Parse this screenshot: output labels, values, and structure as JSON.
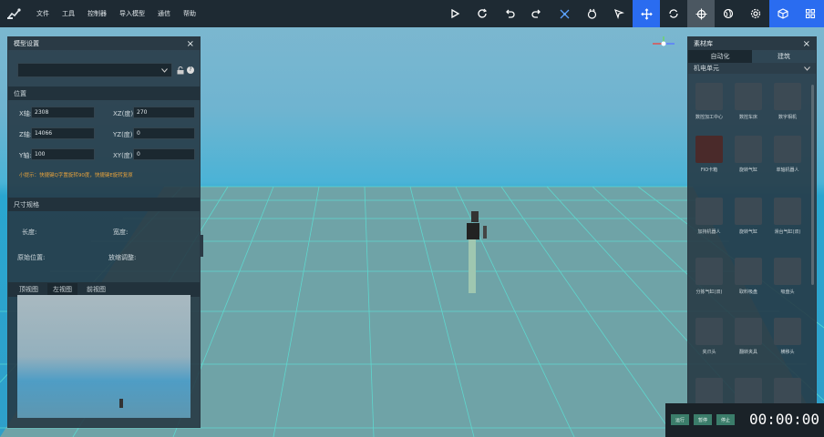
{
  "menu": [
    "文件",
    "工具",
    "控制器",
    "导入模型",
    "通信",
    "帮助"
  ],
  "tool_icons": [
    "play-icon",
    "refresh-icon",
    "undo-icon",
    "redo-icon",
    "drone-icon",
    "robot-hand-icon",
    "cursor-icon",
    "move-icon",
    "rotate-icon",
    "target-icon",
    "globe-icon",
    "gear-icon",
    "cube-icon",
    "grid-icon"
  ],
  "model_panel": {
    "title": "模型设置",
    "close": "×",
    "position_section": "位置",
    "fields": {
      "x_label": "X轴:",
      "x_value": "2308",
      "xz_label": "XZ(度):",
      "xz_value": "270",
      "z_label": "Z轴:",
      "z_value": "14066",
      "yz_label": "YZ(度):",
      "yz_value": "0",
      "y_label": "Y轴:",
      "y_value": "100",
      "xy_label": "XY(度):",
      "xy_value": "0"
    },
    "hint": "小提示：快捷键Q字置旋转90度，快捷键E旋转复原",
    "size_section": "尺寸规格",
    "length_label": "长度:",
    "width_label": "宽度:",
    "origin_label": "原始位置:",
    "speed_label": "放缩调整:",
    "view_tabs": [
      "顶视图",
      "左视图",
      "前视图"
    ],
    "active_tab": 1
  },
  "library_panel": {
    "title": "素材库",
    "close": "×",
    "tabs": [
      "自动化",
      "建筑"
    ],
    "category": "机电单元",
    "items": [
      "数控加工中心",
      "数控车床",
      "数字相机",
      "FIO卡箱",
      "旋转气缸",
      "单轴机器人",
      "加持机器人",
      "旋转气缸",
      "滑台气缸(双)",
      "分拣气缸(双)",
      "取料吸盘",
      "吸盘头",
      "夹爪头",
      "翻转夹具",
      "横移头",
      "托盘",
      "工具头",
      "料仓"
    ]
  },
  "bottom_bar": {
    "buttons": [
      "运行",
      "暂停",
      "停止"
    ],
    "timer": "00:00:00"
  },
  "colors": {
    "topbar": "#1e2a33",
    "accent": "#2a6cf0",
    "hint": "#e6a23c",
    "timer_bg": "#1a2228",
    "button": "#3b7d6a"
  }
}
